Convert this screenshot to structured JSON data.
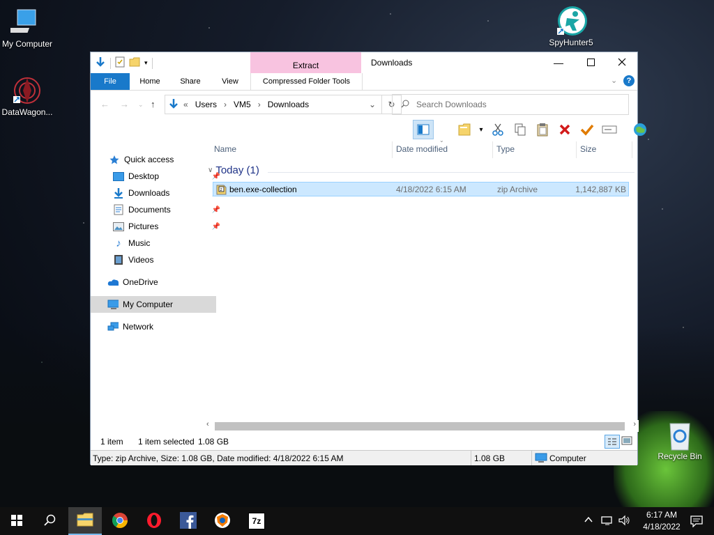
{
  "desktop": {
    "icons": [
      {
        "label": "My Computer",
        "icon": "computer-icon"
      },
      {
        "label": "DataWagon...",
        "icon": "datawagon-icon"
      },
      {
        "label": "SpyHunter5",
        "icon": "spyhunter-icon"
      },
      {
        "label": "Recycle Bin",
        "icon": "recycle-bin-icon"
      }
    ]
  },
  "window": {
    "title": "Downloads",
    "context_tab": "Extract",
    "ribbon_tabs": [
      "File",
      "Home",
      "Share",
      "View",
      "Compressed Folder Tools"
    ],
    "breadcrumb": {
      "overflow": "«",
      "parts": [
        "Users",
        "VM5",
        "Downloads"
      ]
    },
    "search_placeholder": "Search Downloads"
  },
  "nav_pane": {
    "items": [
      {
        "label": "Quick access",
        "icon": "star-icon",
        "pinned": false
      },
      {
        "label": "Desktop",
        "icon": "desktop-folder-icon",
        "pinned": true
      },
      {
        "label": "Downloads",
        "icon": "downloads-folder-icon",
        "pinned": true
      },
      {
        "label": "Documents",
        "icon": "documents-folder-icon",
        "pinned": true
      },
      {
        "label": "Pictures",
        "icon": "pictures-folder-icon",
        "pinned": true
      },
      {
        "label": "Music",
        "icon": "music-folder-icon",
        "pinned": false
      },
      {
        "label": "Videos",
        "icon": "videos-folder-icon",
        "pinned": false
      },
      {
        "label": "OneDrive",
        "icon": "onedrive-icon",
        "pinned": false
      },
      {
        "label": "My Computer",
        "icon": "computer-icon",
        "pinned": false,
        "selected": true
      },
      {
        "label": "Network",
        "icon": "network-icon",
        "pinned": false
      }
    ]
  },
  "file_list": {
    "columns": [
      "Name",
      "Date modified",
      "Type",
      "Size"
    ],
    "group": "Today (1)",
    "rows": [
      {
        "name": "ben.exe-collection",
        "date": "4/18/2022 6:15 AM",
        "type": "zip Archive",
        "size": "1,142,887 KB",
        "selected": true
      }
    ]
  },
  "status": {
    "item_count": "1 item",
    "selection": "1 item selected",
    "selection_size": "1.08 GB",
    "details": "Type: zip Archive, Size: 1.08 GB, Date modified: 4/18/2022 6:15 AM",
    "size_cell": "1.08 GB",
    "location": "Computer"
  },
  "taskbar": {
    "apps": [
      "start-icon",
      "search-icon",
      "file-explorer-icon",
      "chrome-icon",
      "opera-icon",
      "facebook-icon",
      "browser-shield-icon",
      "sevenzip-icon"
    ],
    "sevenzip_label": "7z",
    "time": "6:17 AM",
    "date": "4/18/2022"
  },
  "colors": {
    "accent": "#1979ca",
    "selection_bg": "#cce8ff",
    "context_tab": "#f8c3e0",
    "group_text": "#1e3287"
  }
}
